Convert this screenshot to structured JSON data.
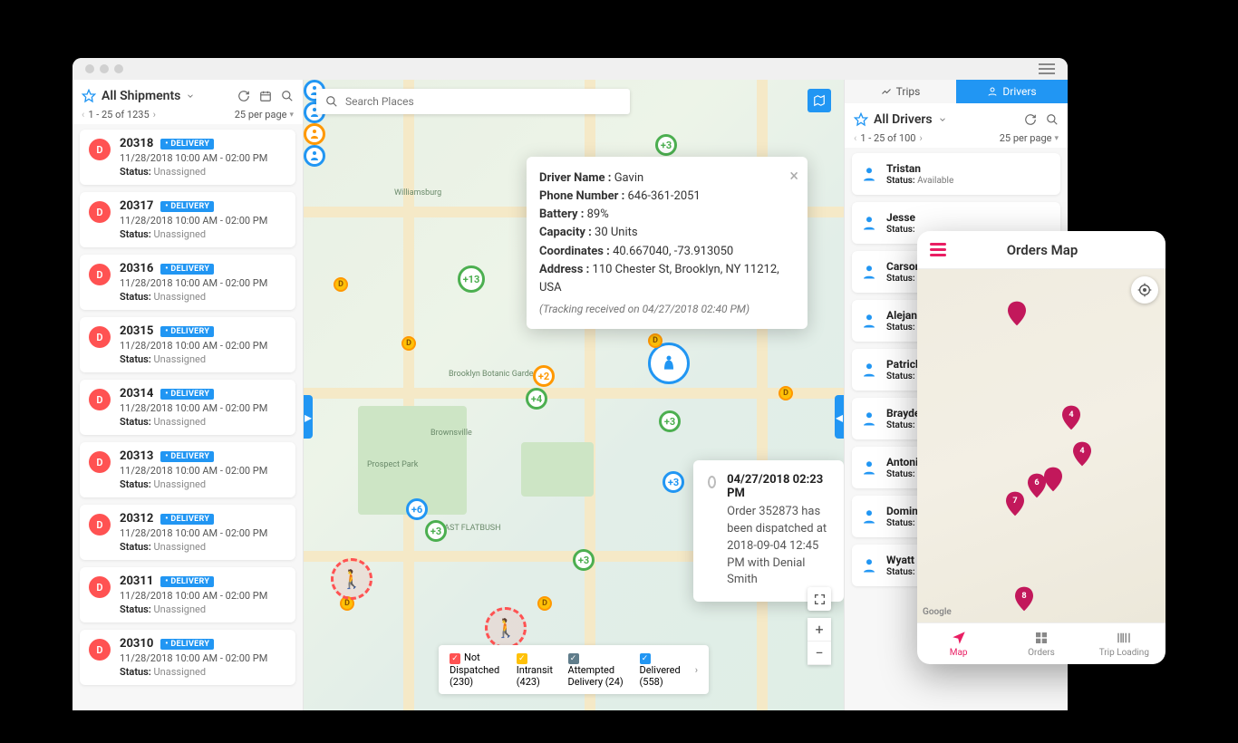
{
  "window": {
    "os_hint": "mac"
  },
  "shipments_panel": {
    "title": "All Shipments",
    "toolbar": {
      "refresh": "refresh",
      "calendar": "calendar",
      "search": "search"
    },
    "range": "1 - 25 of 1235",
    "per_page": "25 per page",
    "status_label": "Status:",
    "items": [
      {
        "id": "20318",
        "badge": "• DELIVERY",
        "time": "11/28/2018 10:00 AM - 02:00 PM",
        "status": "Unassigned",
        "avatar": "D"
      },
      {
        "id": "20317",
        "badge": "• DELIVERY",
        "time": "11/28/2018 10:00 AM - 02:00 PM",
        "status": "Unassigned",
        "avatar": "D"
      },
      {
        "id": "20316",
        "badge": "• DELIVERY",
        "time": "11/28/2018 10:00 AM - 02:00 PM",
        "status": "Unassigned",
        "avatar": "D"
      },
      {
        "id": "20315",
        "badge": "• DELIVERY",
        "time": "11/28/2018 10:00 AM - 02:00 PM",
        "status": "Unassigned",
        "avatar": "D"
      },
      {
        "id": "20314",
        "badge": "• DELIVERY",
        "time": "11/28/2018 10:00 AM - 02:00 PM",
        "status": "Unassigned",
        "avatar": "D"
      },
      {
        "id": "20313",
        "badge": "• DELIVERY",
        "time": "11/28/2018 10:00 AM - 02:00 PM",
        "status": "Unassigned",
        "avatar": "D"
      },
      {
        "id": "20312",
        "badge": "• DELIVERY",
        "time": "11/28/2018 10:00 AM - 02:00 PM",
        "status": "Unassigned",
        "avatar": "D"
      },
      {
        "id": "20311",
        "badge": "• DELIVERY",
        "time": "11/28/2018 10:00 AM - 02:00 PM",
        "status": "Unassigned",
        "avatar": "D"
      },
      {
        "id": "20310",
        "badge": "• DELIVERY",
        "time": "11/28/2018 10:00 AM - 02:00 PM",
        "status": "Unassigned",
        "avatar": "D"
      }
    ]
  },
  "map": {
    "search_placeholder": "Search Places",
    "clusters": {
      "a": "+3",
      "b": "+13",
      "c": "+2",
      "d": "+4",
      "e": "+3",
      "f": "+3",
      "g": "+6",
      "h": "+3",
      "i": "+3",
      "j": "+3"
    },
    "popup": {
      "driver_label": "Driver Name :",
      "driver": "Gavin",
      "phone_label": "Phone Number :",
      "phone": "646-361-2051",
      "battery_label": "Battery :",
      "battery": "89%",
      "capacity_label": "Capacity :",
      "capacity": "30 Units",
      "coords_label": "Coordinates :",
      "coords": "40.667040, -73.913050",
      "address_label": "Address :",
      "address": "110 Chester St, Brooklyn, NY 11212, USA",
      "tracking": "(Tracking received on 04/27/2018 02:40 PM)"
    },
    "event": {
      "ts": "04/27/2018 02:23 PM",
      "msg": "Order 352873 has been dispatched at 2018-09-04 12:45 PM with Denial Smith"
    },
    "legend": {
      "a": "Not Dispatched (230)",
      "b": "Intransit (423)",
      "c": "Attempted Delivery (24)",
      "d": "Delivered (558)"
    }
  },
  "drivers_panel": {
    "tabs": {
      "trips": "Trips",
      "drivers": "Drivers"
    },
    "title": "All Drivers",
    "range": "1 - 25 of 100",
    "per_page": "25 per page",
    "status_label": "Status:",
    "items": [
      {
        "name": "Tristan",
        "status": "Available"
      },
      {
        "name": "Jesse",
        "status": ""
      },
      {
        "name": "Carson",
        "status": ""
      },
      {
        "name": "Alejan",
        "status": ""
      },
      {
        "name": "Patrick",
        "status": ""
      },
      {
        "name": "Brayde",
        "status": ""
      },
      {
        "name": "Antoni",
        "status": ""
      },
      {
        "name": "Domin",
        "status": ""
      },
      {
        "name": "Wyatt",
        "status": ""
      }
    ]
  },
  "mobile": {
    "title": "Orders Map",
    "pins": {
      "a": "4",
      "b": "6",
      "c": "7",
      "d": "8",
      "e": "4"
    },
    "tabs": {
      "map": "Map",
      "orders": "Orders",
      "trip": "Trip Loading"
    }
  }
}
